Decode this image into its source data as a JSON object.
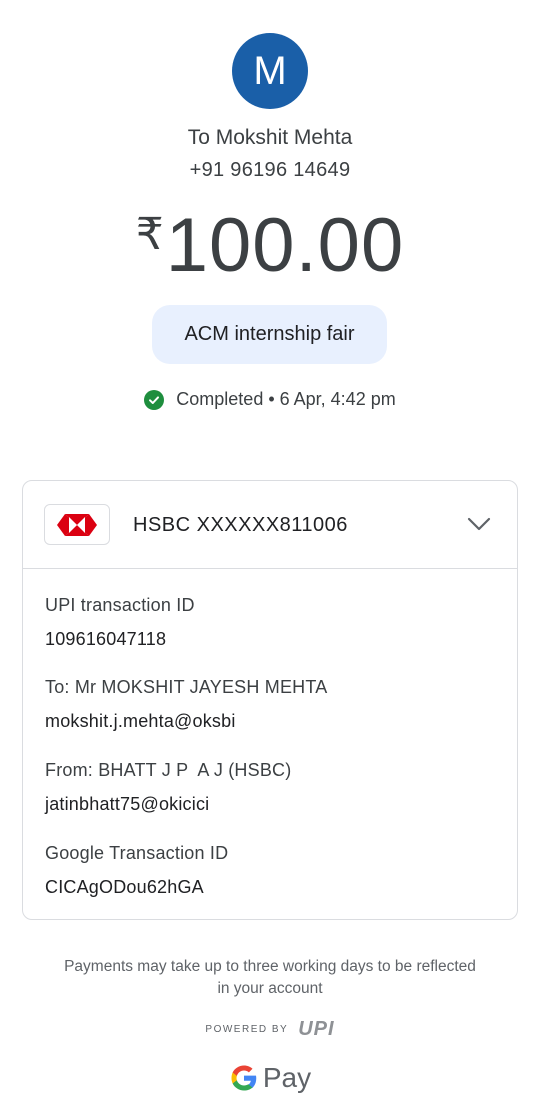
{
  "recipient": {
    "avatar_initial": "M",
    "avatar_color": "#1a5fa8",
    "name_line": "To Mokshit Mehta",
    "phone": "+91 96196 14649"
  },
  "amount": {
    "currency_symbol": "₹",
    "value": "100.00"
  },
  "note": "ACM internship fair",
  "status": {
    "icon": "check-circle-icon",
    "text": "Completed • 6 Apr, 4:42 pm",
    "color": "#1e8e3e"
  },
  "account": {
    "bank_logo": "hsbc-logo",
    "bank_label": "HSBC XXXXXX811006",
    "expand_icon": "chevron-down-icon"
  },
  "details": {
    "upi_label": "UPI transaction ID",
    "upi_value": "109616047118",
    "to_label": "To: Mr MOKSHIT JAYESH MEHTA",
    "to_value": "mokshit.j.mehta@oksbi",
    "from_label": "From: BHATT J P  A J (HSBC)",
    "from_value": "jatinbhatt75@okicici",
    "google_label": "Google Transaction ID",
    "google_value": "CICAgODou62hGA"
  },
  "footer": {
    "disclaimer": "Payments may take up to three working days to be reflected in your account",
    "powered_by": "POWERED BY",
    "upi_logo_text": "UPI",
    "gpay_pay": "Pay"
  }
}
